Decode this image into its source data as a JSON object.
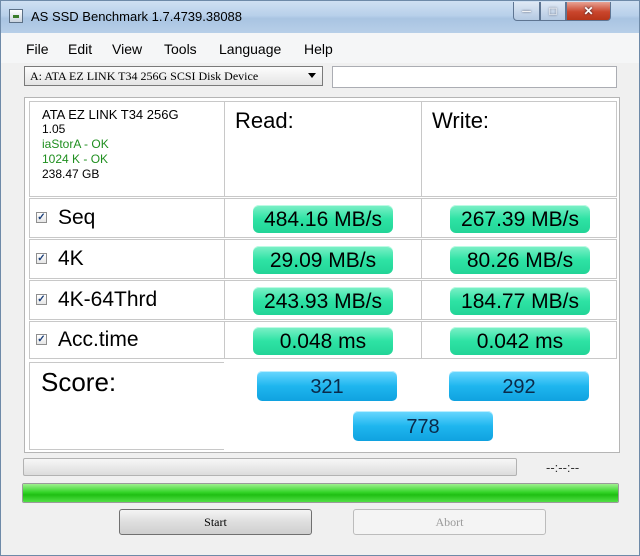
{
  "window": {
    "title": "AS SSD Benchmark 1.7.4739.38088",
    "min_glyph": "─",
    "max_glyph": "□",
    "close_glyph": "✕"
  },
  "menu": [
    "File",
    "Edit",
    "View",
    "Tools",
    "Language",
    "Help"
  ],
  "drive_select": {
    "value": "A: ATA EZ LINK T34 256G SCSI Disk Device"
  },
  "drive_info": {
    "name": "ATA EZ LINK T34 256G",
    "firmware": "1.05",
    "driver_status": "iaStorA - OK",
    "alignment_status": "1024 K - OK",
    "size": "238.47 GB"
  },
  "headers": {
    "read": "Read:",
    "write": "Write:"
  },
  "tests": [
    {
      "label": "Seq",
      "checked": true,
      "read": "484.16 MB/s",
      "write": "267.39 MB/s"
    },
    {
      "label": "4K",
      "checked": true,
      "read": "29.09 MB/s",
      "write": "80.26 MB/s"
    },
    {
      "label": "4K-64Thrd",
      "checked": true,
      "read": "243.93 MB/s",
      "write": "184.77 MB/s"
    },
    {
      "label": "Acc.time",
      "checked": true,
      "read": "0.048 ms",
      "write": "0.042 ms"
    }
  ],
  "checkmark": "✓",
  "score": {
    "label": "Score:",
    "read": "321",
    "write": "292",
    "total": "778"
  },
  "timer": "--:--:--",
  "progress": {
    "test_fraction": 0.0,
    "total_fraction": 1.0
  },
  "buttons": {
    "start": "Start",
    "abort": "Abort"
  }
}
